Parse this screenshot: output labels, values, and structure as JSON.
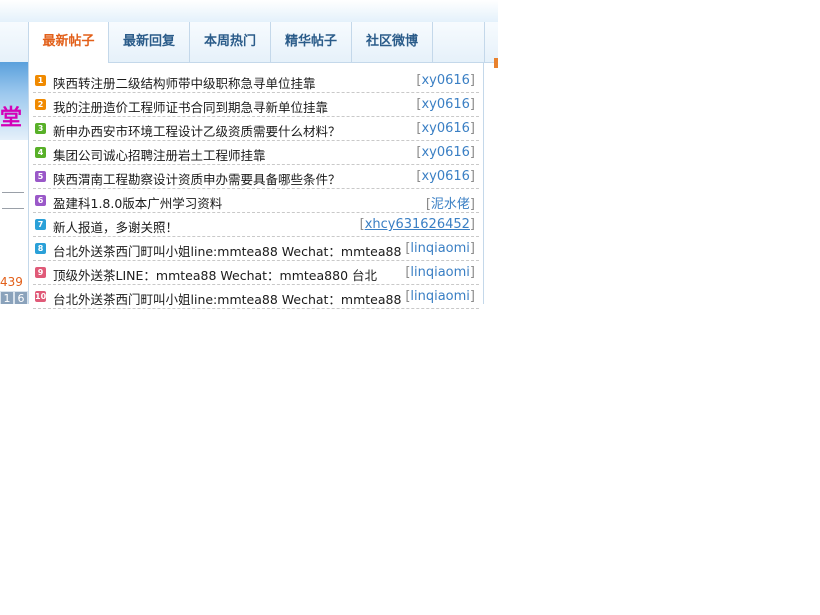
{
  "tabs": [
    {
      "label": "最新帖子",
      "active": true,
      "width": 79
    },
    {
      "label": "最新回复",
      "active": false,
      "width": 80
    },
    {
      "label": "本周热门",
      "active": false,
      "width": 80
    },
    {
      "label": "精华帖子",
      "active": false,
      "width": 80
    },
    {
      "label": "社区微博",
      "active": false,
      "width": 80
    }
  ],
  "posts": [
    {
      "n": "1",
      "color": "#f08a00",
      "title": "陕西转注册二级结构师带中级职称急寻单位挂靠",
      "author": "xy0616",
      "underline": false
    },
    {
      "n": "2",
      "color": "#f08a00",
      "title": "我的注册造价工程师证书合同到期急寻新单位挂靠",
      "author": "xy0616",
      "underline": false
    },
    {
      "n": "3",
      "color": "#58b028",
      "title": "新申办西安市环境工程设计乙级资质需要什么材料？",
      "author": "xy0616",
      "underline": false
    },
    {
      "n": "4",
      "color": "#58b028",
      "title": "集团公司诚心招聘注册岩土工程师挂靠",
      "author": "xy0616",
      "underline": false
    },
    {
      "n": "5",
      "color": "#9a58c8",
      "title": "陕西渭南工程勘察设计资质申办需要具备哪些条件？",
      "author": "xy0616",
      "underline": false
    },
    {
      "n": "6",
      "color": "#9a58c8",
      "title": "盈建科1.8.0版本广州学习资料",
      "author": "泥水佬",
      "underline": false
    },
    {
      "n": "7",
      "color": "#2aa0d8",
      "title": "新人报道，多谢关照！",
      "author": "xhcy631626452",
      "underline": true
    },
    {
      "n": "8",
      "color": "#2aa0d8",
      "title": "台北外送茶西门町叫小姐line:mmtea88 Wechat：mmtea88",
      "author": "linqiaomi",
      "underline": false
    },
    {
      "n": "9",
      "color": "#e05a78",
      "title": "顶级外送茶LINE：mmtea88 Wechat：mmtea880 台北",
      "author": "linqiaomi",
      "underline": false
    },
    {
      "n": "10",
      "color": "#e05a78",
      "title": "台北外送茶西门町叫小姐line:mmtea88 Wechat：mmtea88",
      "author": "linqiaomi",
      "underline": false
    }
  ],
  "left": {
    "number": "439",
    "box_a": "1",
    "box_b": "6"
  }
}
